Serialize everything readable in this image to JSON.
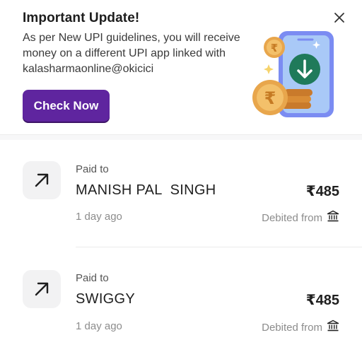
{
  "banner": {
    "title": "Important Update!",
    "message": "As per New UPI guidelines, you will receive money on a different UPI app linked with kalasharmaonline@okicici",
    "button_label": "Check Now",
    "close_icon": "close-icon",
    "illustration": "phone-receive-money-illustration",
    "rupee_symbol": "₹",
    "accent_color": "#5f259f"
  },
  "transactions": [
    {
      "label": "Paid to",
      "name": "MANISH PAL  SINGH",
      "amount": "₹485",
      "time": "1 day ago",
      "debited": "Debited from",
      "direction_icon": "arrow-up-right-icon",
      "source_icon": "bank-icon"
    },
    {
      "label": "Paid to",
      "name": "SWIGGY",
      "amount": "₹485",
      "time": "1 day ago",
      "debited": "Debited from",
      "direction_icon": "arrow-up-right-icon",
      "source_icon": "bank-icon"
    }
  ]
}
